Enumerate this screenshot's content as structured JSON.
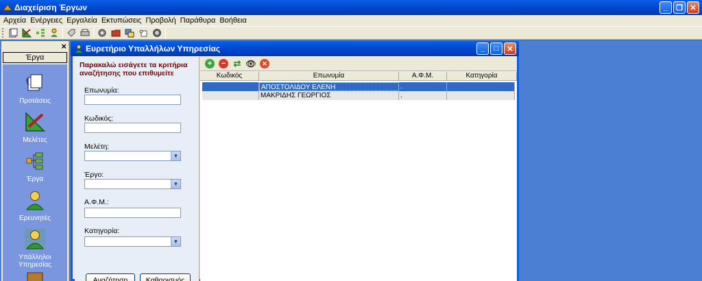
{
  "app": {
    "title": "Διαχείριση Έργων",
    "title_color": "#0a5ee8"
  },
  "menu": [
    "Αρχεία",
    "Ενέργειες",
    "Εργαλεία",
    "Εκτυπώσεις",
    "Προβολή",
    "Παράθυρα",
    "Βοήθεια"
  ],
  "toolbar_icons": [
    "proposals-icon",
    "studies-icon",
    "projects-icon",
    "researchers-icon",
    "tag-icon",
    "printer-icon",
    "gear-icon",
    "folder-icon",
    "windows-icon",
    "copy-icon",
    "disc-icon"
  ],
  "sidepanel": {
    "close": "×",
    "header": "Έργα",
    "items": [
      {
        "label": "Προτάσεις",
        "icon": "proposals-icon"
      },
      {
        "label": "Μελέτες",
        "icon": "studies-icon"
      },
      {
        "label": "Έργα",
        "icon": "projects-icon"
      },
      {
        "label": "Ερευνητές",
        "icon": "researcher-icon"
      },
      {
        "label": "Υπάλληλοι Υπηρεσίας",
        "icon": "employee-icon"
      }
    ]
  },
  "child_window": {
    "title": "Ευρετήριο Υπαλλήλων Υπηρεσίας"
  },
  "search_form": {
    "hint": "Παρακαλώ εισάγετε τα κριτήρια αναζήτησης που επιθυμείτε",
    "fields": {
      "name_label": "Επωνυμία:",
      "name_value": "",
      "code_label": "Κωδικός:",
      "code_value": "",
      "study_label": "Μελέτη:",
      "study_value": "",
      "project_label": "Έργο:",
      "project_value": "",
      "afm_label": "Α.Φ.Μ.:",
      "afm_value": "",
      "category_label": "Κατηγορία:",
      "category_value": ""
    },
    "search_button": "Αναζήτηση",
    "clear_button": "Καθαρισμός"
  },
  "grid": {
    "toolbar_icons": [
      "add-icon",
      "remove-icon",
      "refresh-icon",
      "view-icon",
      "delete-icon"
    ],
    "columns": [
      "Κωδικός",
      "Επωνυμία",
      "Α.Φ.Μ.",
      "Κατηγορία"
    ],
    "rows": [
      {
        "code": "",
        "name": "ΑΠΟΣΤΟΛΙΔΟΥ ΕΛΕΝΗ",
        "afm": ".",
        "category": "",
        "selected": true
      },
      {
        "code": "",
        "name": "ΜΑΚΡΙΔΗΣ ΓΕΩΡΓΙΟΣ",
        "afm": ".",
        "category": "",
        "selected": false
      }
    ]
  },
  "colors": {
    "workspace": "#4a7fd3",
    "selected_row": "#316ac5",
    "hint_text": "#7a0000"
  }
}
